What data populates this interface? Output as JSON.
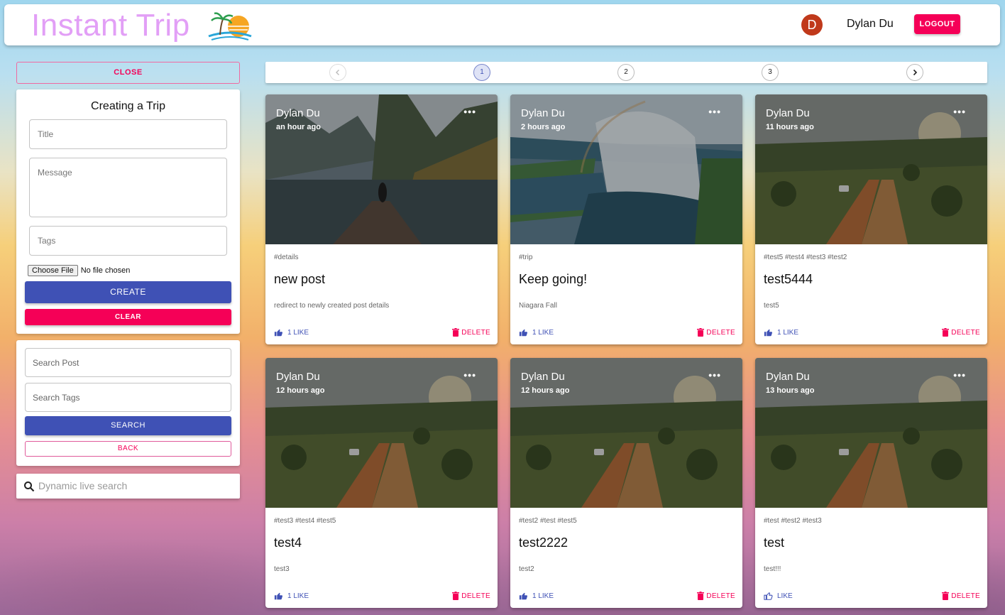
{
  "header": {
    "brand": "Instant Trip",
    "user_initial": "D",
    "user_name": "Dylan Du",
    "logout_label": "LOGOUT"
  },
  "sidebar": {
    "close_label": "CLOSE",
    "form": {
      "title": "Creating a Trip",
      "title_placeholder": "Title",
      "message_placeholder": "Message",
      "tags_placeholder": "Tags",
      "file_button": "Choose File",
      "file_status": "No file chosen",
      "create_label": "CREATE",
      "clear_label": "CLEAR"
    },
    "search": {
      "post_placeholder": "Search Post",
      "tags_placeholder": "Search Tags",
      "search_label": "SEARCH",
      "back_label": "BACK"
    },
    "live_search_placeholder": "Dynamic live search"
  },
  "pagination": {
    "pages": [
      "1",
      "2",
      "3"
    ],
    "current": "1"
  },
  "posts": [
    {
      "author": "Dylan Du",
      "time": "an hour ago",
      "tags": "#details",
      "title": "new post",
      "message": "redirect to newly created post details",
      "like": "1 LIKE",
      "delete": "DELETE",
      "image": "lake-dock"
    },
    {
      "author": "Dylan Du",
      "time": "2 hours ago",
      "tags": "#trip",
      "title": "Keep going!",
      "message": "Niagara Fall",
      "like": "1 LIKE",
      "delete": "DELETE",
      "image": "waterfall"
    },
    {
      "author": "Dylan Du",
      "time": "11 hours ago",
      "tags": "#test5 #test4 #test3 #test2",
      "title": "test5444",
      "message": "test5",
      "like": "1 LIKE",
      "delete": "DELETE",
      "image": "desert-road"
    },
    {
      "author": "Dylan Du",
      "time": "12 hours ago",
      "tags": "#test3 #test4 #test5",
      "title": "test4",
      "message": "test3",
      "like": "1 LIKE",
      "delete": "DELETE",
      "image": "desert-road"
    },
    {
      "author": "Dylan Du",
      "time": "12 hours ago",
      "tags": "#test2 #test #test5",
      "title": "test2222",
      "message": "test2",
      "like": "1 LIKE",
      "delete": "DELETE",
      "image": "desert-road"
    },
    {
      "author": "Dylan Du",
      "time": "13 hours ago",
      "tags": "#test #test2 #test3",
      "title": "test",
      "message": "test!!!",
      "like": "LIKE",
      "delete": "DELETE",
      "image": "desert-road"
    }
  ],
  "colors": {
    "primary": "#3f51b5",
    "secondary": "#f50057",
    "brand": "#e29ff6"
  }
}
